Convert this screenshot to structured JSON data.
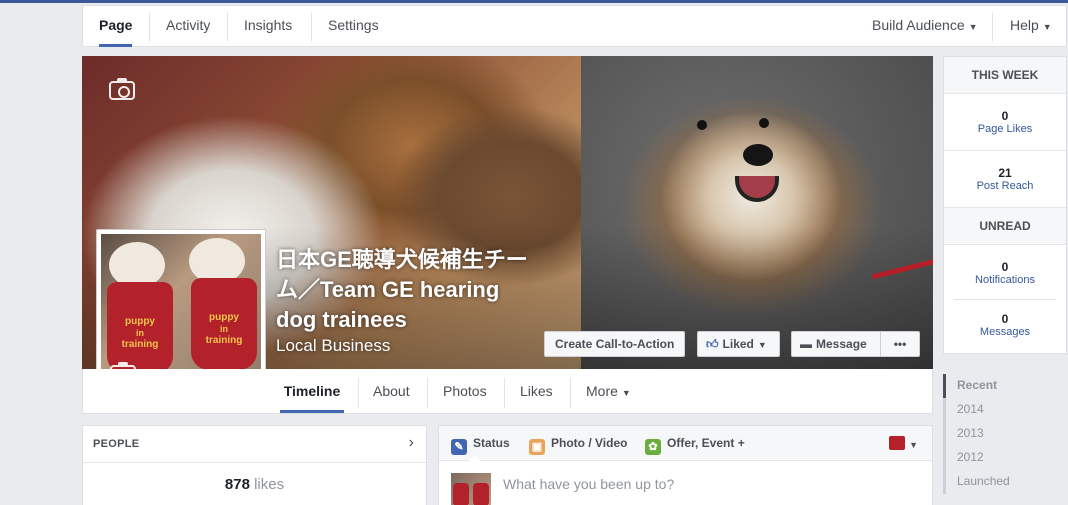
{
  "admin_nav": {
    "tabs": [
      {
        "label": "Page",
        "active": true
      },
      {
        "label": "Activity",
        "active": false
      },
      {
        "label": "Insights",
        "active": false
      },
      {
        "label": "Settings",
        "active": false
      }
    ],
    "build_audience": "Build Audience",
    "help": "Help"
  },
  "page": {
    "name": "日本GE聴導犬候補生チーム／Team GE hearing dog trainees",
    "category": "Local Business",
    "profile_shirt_text": [
      "puppy",
      "in",
      "training"
    ]
  },
  "cover_buttons": {
    "cta": "Create Call-to-Action",
    "liked": "Liked",
    "message": "Message",
    "more_dots": "•••"
  },
  "page_tabs": [
    {
      "label": "Timeline",
      "active": true
    },
    {
      "label": "About",
      "active": false
    },
    {
      "label": "Photos",
      "active": false
    },
    {
      "label": "Likes",
      "active": false
    },
    {
      "label": "More",
      "active": false
    }
  ],
  "stats": {
    "this_week_heading": "THIS WEEK",
    "page_likes": {
      "value": "0",
      "label": "Page Likes"
    },
    "post_reach": {
      "value": "21",
      "label": "Post Reach"
    },
    "unread_heading": "UNREAD",
    "notifications": {
      "value": "0",
      "label": "Notifications"
    },
    "messages": {
      "value": "0",
      "label": "Messages"
    }
  },
  "timeline_years": [
    {
      "label": "Recent",
      "active": true
    },
    {
      "label": "2014",
      "active": false
    },
    {
      "label": "2013",
      "active": false
    },
    {
      "label": "2012",
      "active": false
    },
    {
      "label": "Launched",
      "active": false
    }
  ],
  "people": {
    "title": "PEOPLE",
    "likes_count": "878",
    "likes_word": "likes"
  },
  "composer": {
    "status": "Status",
    "photo_video": "Photo / Video",
    "offer_event": "Offer, Event +",
    "placeholder": "What have you been up to?"
  },
  "colors": {
    "brand": "#3b5998",
    "accent": "#4267b2",
    "link": "#365899"
  }
}
